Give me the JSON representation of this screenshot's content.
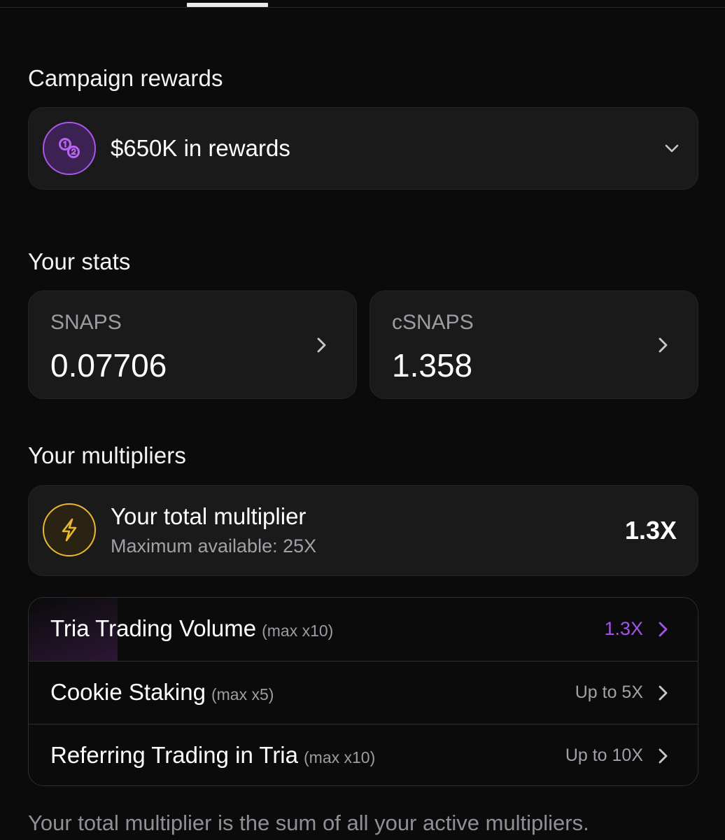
{
  "campaign_rewards": {
    "title": "Campaign rewards",
    "rewards_label": "$650K in rewards",
    "icon": "coins-icon"
  },
  "stats": {
    "title": "Your stats",
    "cards": [
      {
        "label": "SNAPS",
        "value": "0.07706"
      },
      {
        "label": "cSNAPS",
        "value": "1.358"
      }
    ]
  },
  "multipliers": {
    "title": "Your multipliers",
    "total": {
      "title": "Your total multiplier",
      "subtitle": "Maximum available: 25X",
      "value": "1.3X",
      "icon": "lightning-bolt-icon"
    },
    "items": [
      {
        "label": "Tria Trading Volume",
        "max": "(max x10)",
        "value": "1.3X"
      },
      {
        "label": "Cookie Staking",
        "max": "(max x5)",
        "value": "Up to 5X"
      },
      {
        "label": "Referring Trading in Tria",
        "max": "(max x10)",
        "value": "Up to 10X"
      }
    ],
    "footer_note": "Your total multiplier is the sum of all your active multipliers."
  },
  "colors": {
    "background": "#0b0b0c",
    "card": "#1a1a1b",
    "accent_purple": "#a254e8",
    "accent_gold": "#e8b92f"
  }
}
